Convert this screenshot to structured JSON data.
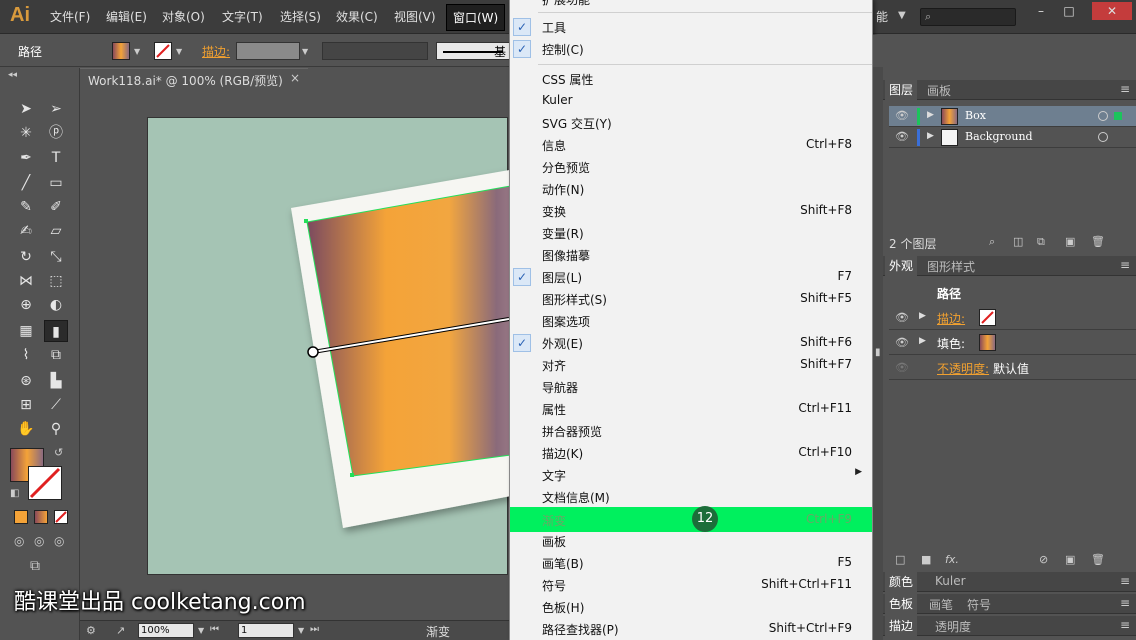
{
  "app": {
    "logo": "Ai",
    "menus": [
      "文件(F)",
      "编辑(E)",
      "对象(O)",
      "文字(T)",
      "选择(S)",
      "效果(C)",
      "视图(V)",
      "窗口(W)"
    ],
    "active_menu": "窗口(W)",
    "header_partial_text": "能"
  },
  "control": {
    "object_type": "路径",
    "stroke_label": "描边:",
    "line_style_label": "基"
  },
  "document": {
    "tab_title": "Work118.ai* @ 100% (RGB/预览)",
    "tab_close": "×"
  },
  "status": {
    "zoom": "100%",
    "page": "1",
    "text": "渐变"
  },
  "window_menu": {
    "top_partial": "扩展功能",
    "items": [
      {
        "label": "工具",
        "shortcut": "",
        "checked": true
      },
      {
        "label": "控制(C)",
        "shortcut": "",
        "checked": true
      },
      {
        "label": "CSS 属性",
        "shortcut": "",
        "checked": false
      },
      {
        "label": "Kuler",
        "shortcut": "",
        "checked": false
      },
      {
        "label": "SVG 交互(Y)",
        "shortcut": "",
        "checked": false
      },
      {
        "label": "信息",
        "shortcut": "Ctrl+F8",
        "checked": false
      },
      {
        "label": "分色预览",
        "shortcut": "",
        "checked": false
      },
      {
        "label": "动作(N)",
        "shortcut": "",
        "checked": false
      },
      {
        "label": "变换",
        "shortcut": "Shift+F8",
        "checked": false
      },
      {
        "label": "变量(R)",
        "shortcut": "",
        "checked": false
      },
      {
        "label": "图像描摹",
        "shortcut": "",
        "checked": false
      },
      {
        "label": "图层(L)",
        "shortcut": "F7",
        "checked": true
      },
      {
        "label": "图形样式(S)",
        "shortcut": "Shift+F5",
        "checked": false
      },
      {
        "label": "图案选项",
        "shortcut": "",
        "checked": false
      },
      {
        "label": "外观(E)",
        "shortcut": "Shift+F6",
        "checked": true
      },
      {
        "label": "对齐",
        "shortcut": "Shift+F7",
        "checked": false
      },
      {
        "label": "导航器",
        "shortcut": "",
        "checked": false
      },
      {
        "label": "属性",
        "shortcut": "Ctrl+F11",
        "checked": false
      },
      {
        "label": "拼合器预览",
        "shortcut": "",
        "checked": false
      },
      {
        "label": "描边(K)",
        "shortcut": "Ctrl+F10",
        "checked": false
      },
      {
        "label": "文字",
        "shortcut": "",
        "checked": false,
        "submenu": true
      },
      {
        "label": "文档信息(M)",
        "shortcut": "",
        "checked": false
      },
      {
        "label": "渐变",
        "shortcut": "Ctrl+F9",
        "checked": false,
        "highlighted": true
      },
      {
        "label": "画板",
        "shortcut": "",
        "checked": false
      },
      {
        "label": "画笔(B)",
        "shortcut": "F5",
        "checked": false
      },
      {
        "label": "符号",
        "shortcut": "Shift+Ctrl+F11",
        "checked": false
      },
      {
        "label": "色板(H)",
        "shortcut": "",
        "checked": false
      },
      {
        "label": "路径查找器(P)",
        "shortcut": "Shift+Ctrl+F9",
        "checked": false
      }
    ],
    "step_badge": "12"
  },
  "layers_panel": {
    "tabs": [
      "图层",
      "画板"
    ],
    "layers": [
      {
        "name": "Box",
        "color": "#1cc45c",
        "selected": true
      },
      {
        "name": "Background",
        "color": "#3a6fd8",
        "selected": false
      }
    ],
    "count_text": "2 个图层"
  },
  "appearance_panel": {
    "tabs": [
      "外观",
      "图形样式"
    ],
    "object": "路径",
    "stroke_label": "描边:",
    "fill_label": "填色:",
    "opacity_label": "不透明度:",
    "opacity_value": "默认值"
  },
  "bottom_panels": {
    "color_tabs": [
      "颜色",
      "Kuler"
    ],
    "swatch_tabs": [
      "色板",
      "画笔",
      "符号"
    ],
    "stroke_tabs": [
      "描边",
      "透明度"
    ]
  },
  "watermark": "酷课堂出品 coolketang.com",
  "colors": {
    "highlight": "#00f05e",
    "artboard": "#a5c4b4",
    "accent_orange": "#f0a030"
  }
}
